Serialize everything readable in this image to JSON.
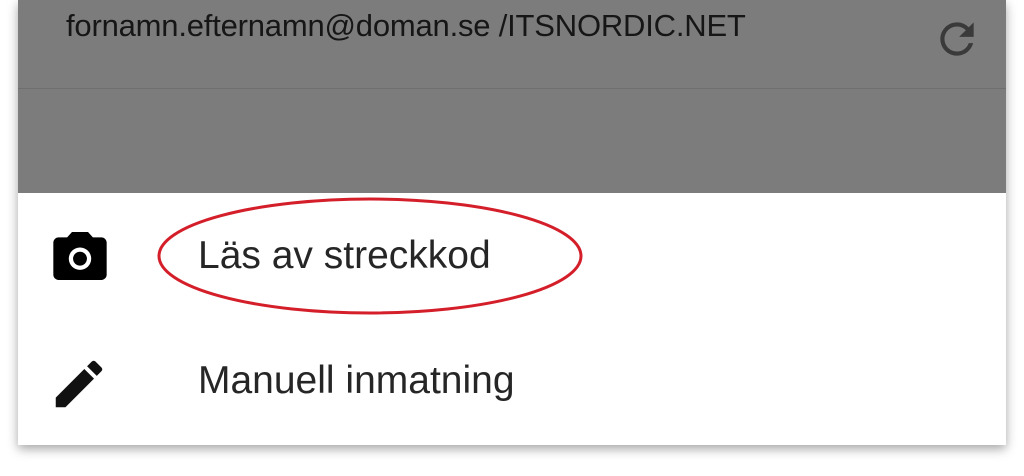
{
  "header": {
    "account": "fornamn.efternamn@doman.se /ITSNORDIC.NET",
    "refresh_icon": "refresh-icon",
    "background": "#7c7c7c"
  },
  "menu": {
    "items": [
      {
        "icon": "camera-icon",
        "label": "Läs av streckkod"
      },
      {
        "icon": "pencil-icon",
        "label": "Manuell inmatning"
      }
    ]
  },
  "annotation": {
    "shape": "ellipse",
    "color": "#d41f2a"
  }
}
